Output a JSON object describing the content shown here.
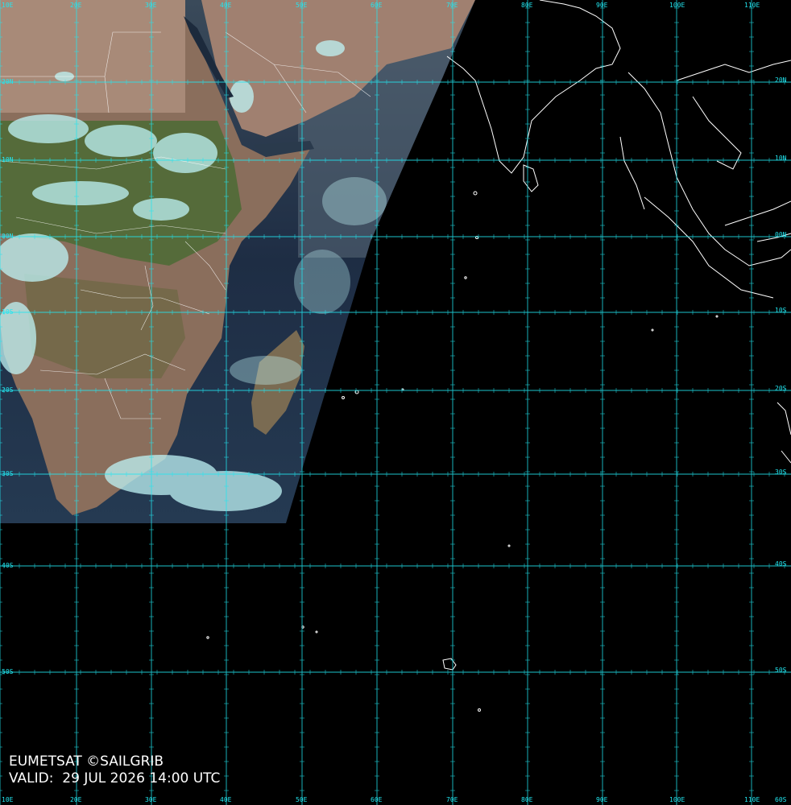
{
  "map": {
    "credit": "EUMETSAT ©SAILGRIB",
    "valid_label": "VALID:",
    "valid_time": "29 JUL 2026 14:00 UTC",
    "grid_color": "#22e6f0",
    "coastline_color": "#ffffff",
    "background_color": "#000000",
    "longitude_labels": [
      "10E",
      "20E",
      "30E",
      "40E",
      "50E",
      "60E",
      "70E",
      "80E",
      "90E",
      "100E",
      "110E"
    ],
    "latitude_labels_east": [
      "20N",
      "10N",
      "00N",
      "10S",
      "20S",
      "30S",
      "40S",
      "50S",
      "60S"
    ],
    "latitude_labels_west": [
      "20N",
      "10N",
      "00N",
      "10S",
      "20S",
      "30S",
      "40S",
      "50S"
    ],
    "bottom_longitude_labels": [
      "10E",
      "20E",
      "30E",
      "40E",
      "50E",
      "60E",
      "70E",
      "80E",
      "90E",
      "100E",
      "110E"
    ]
  }
}
